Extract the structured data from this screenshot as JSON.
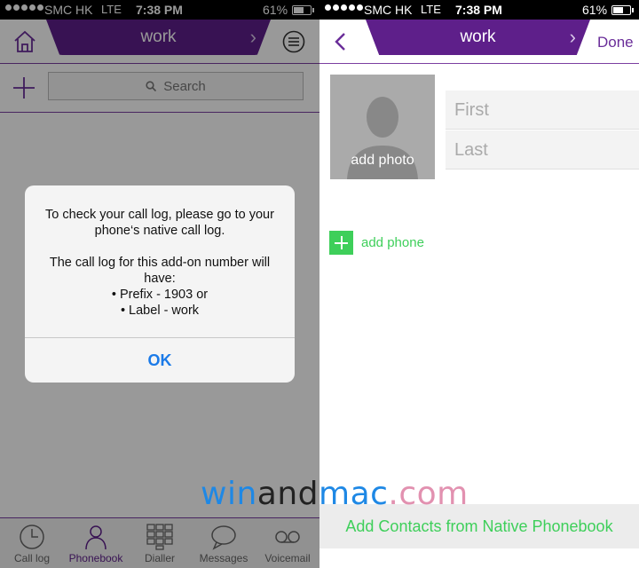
{
  "status_bar": {
    "carrier": "SMC HK",
    "network": "LTE",
    "time": "7:38 PM",
    "battery": "61%"
  },
  "left_screen": {
    "nav_title": "work",
    "search_placeholder": "Search",
    "alert": {
      "line1": "To check your call log, please go to your phone‘s native call log.",
      "line2": "The call log for this add-on number will have:",
      "bullet1": "• Prefix  - 1903 or",
      "bullet2": "• Label  -  work",
      "ok_label": "OK"
    },
    "tab_bar": [
      {
        "label": "Call log",
        "icon": "clock-icon",
        "active": false
      },
      {
        "label": "Phonebook",
        "icon": "person-icon",
        "active": true
      },
      {
        "label": "Dialler",
        "icon": "keypad-icon",
        "active": false
      },
      {
        "label": "Messages",
        "icon": "chat-bubble-icon",
        "active": false
      },
      {
        "label": "Voicemail",
        "icon": "voicemail-icon",
        "active": false
      }
    ]
  },
  "right_screen": {
    "nav_title": "work",
    "done_label": "Done",
    "add_photo_label": "add photo",
    "first_placeholder": "First",
    "last_placeholder": "Last",
    "add_phone_label": "add phone",
    "native_button_label": "Add Contacts from Native Phonebook"
  },
  "watermark": {
    "part1": "win",
    "part2": "and",
    "part3": "mac",
    "part4": ".com"
  },
  "colors": {
    "brand_purple": "#5e1f8a",
    "accent_green": "#3ecf5a",
    "ios_blue": "#1a7ae8"
  }
}
